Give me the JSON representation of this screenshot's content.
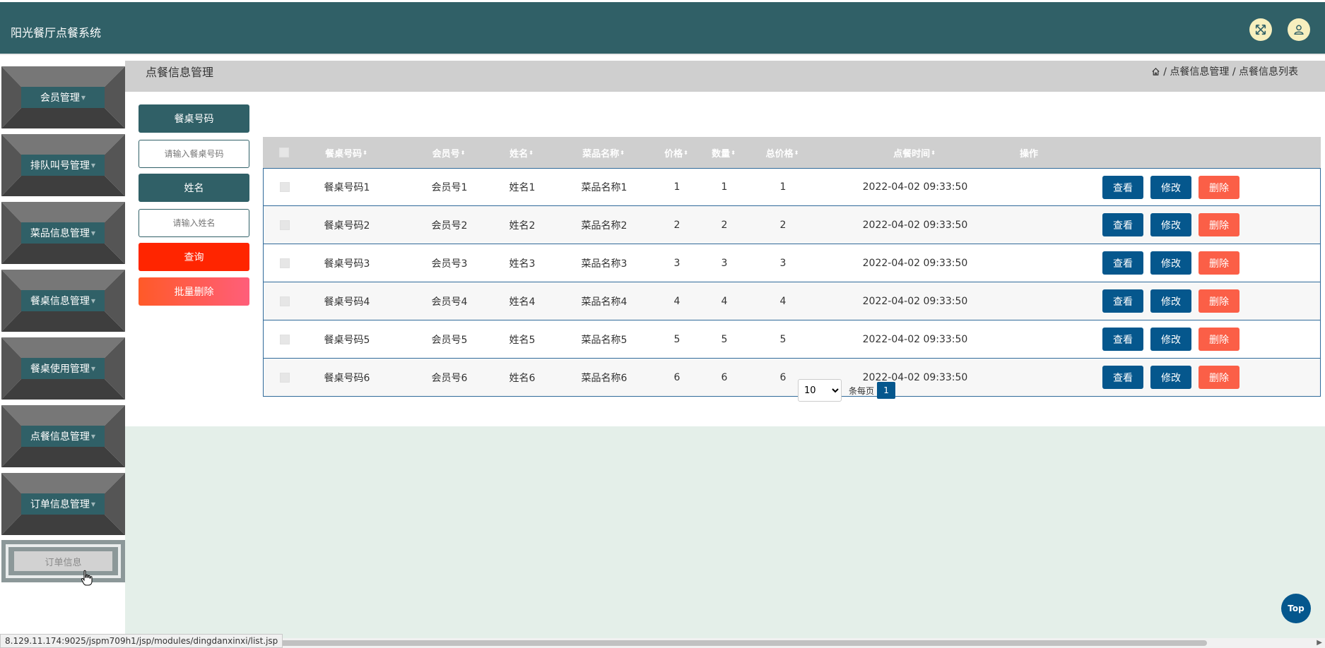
{
  "app": {
    "title": "阳光餐厅点餐系统",
    "colors": {
      "header": "#306067",
      "primary": "#05578d",
      "danger": "#fb5f47",
      "query": "#ff2500"
    },
    "header_icons": [
      "fullscreen-icon",
      "user-icon"
    ]
  },
  "sidebar": {
    "items": [
      {
        "label": "会员管理"
      },
      {
        "label": "排队叫号管理"
      },
      {
        "label": "菜品信息管理"
      },
      {
        "label": "餐桌信息管理"
      },
      {
        "label": "餐桌使用管理"
      },
      {
        "label": "点餐信息管理"
      },
      {
        "label": "订单信息管理"
      }
    ],
    "sub_item": "订单信息"
  },
  "page": {
    "title": "点餐信息管理",
    "breadcrumb": "/ 点餐信息管理 / 点餐信息列表"
  },
  "search": {
    "table_label": "餐桌号码",
    "table_placeholder": "请输入餐桌号码",
    "name_label": "姓名",
    "name_placeholder": "请输入姓名",
    "query_button": "查询",
    "batch_delete_button": "批量删除"
  },
  "table": {
    "headers": [
      "餐桌号码",
      "会员号",
      "姓名",
      "菜品名称",
      "价格",
      "数量",
      "总价格",
      "点餐时间",
      "操作"
    ],
    "sort_icon": "⬍",
    "rows": [
      [
        "餐桌号码1",
        "会员号1",
        "姓名1",
        "菜品名称1",
        "1",
        "1",
        "1",
        "2022-04-02 09:33:50"
      ],
      [
        "餐桌号码2",
        "会员号2",
        "姓名2",
        "菜品名称2",
        "2",
        "2",
        "2",
        "2022-04-02 09:33:50"
      ],
      [
        "餐桌号码3",
        "会员号3",
        "姓名3",
        "菜品名称3",
        "3",
        "3",
        "3",
        "2022-04-02 09:33:50"
      ],
      [
        "餐桌号码4",
        "会员号4",
        "姓名4",
        "菜品名称4",
        "4",
        "4",
        "4",
        "2022-04-02 09:33:50"
      ],
      [
        "餐桌号码5",
        "会员号5",
        "姓名5",
        "菜品名称5",
        "5",
        "5",
        "5",
        "2022-04-02 09:33:50"
      ],
      [
        "餐桌号码6",
        "会员号6",
        "姓名6",
        "菜品名称6",
        "6",
        "6",
        "6",
        "2022-04-02 09:33:50"
      ]
    ],
    "actions": {
      "view": "查看",
      "edit": "修改",
      "delete": "删除"
    }
  },
  "pagination": {
    "page_size": "10",
    "per_page_label": "条每页",
    "current_page": "1"
  },
  "top_button": "Top",
  "status_url": "8.129.11.174:9025/jspm709h1/jsp/modules/dingdanxinxi/list.jsp"
}
